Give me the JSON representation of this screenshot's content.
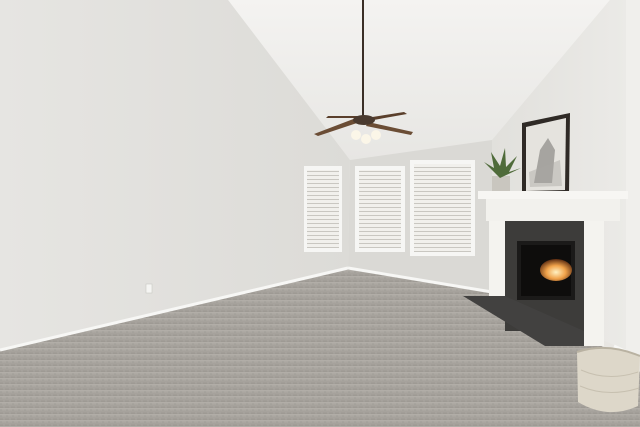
{
  "scene": {
    "subject": "empty-living-room",
    "colors": {
      "left_wall": "#e4e3df",
      "back_wall": "#dcdbd7",
      "right_wall": "#e9e8e5",
      "ceiling": "#f1f0ee",
      "carpet": "#a7a39d",
      "mantel": "#f7f6f3",
      "tile": "#3d3c3a",
      "fan_blade": "#6b4d35",
      "basket": "#ddd7c9"
    },
    "objects": {
      "ceiling_fan": "ceiling-fan",
      "fireplace": "fireplace",
      "framed_art": "framed-art",
      "potted_plant": "potted-plant",
      "wicker_basket": "wicker-basket",
      "windows": [
        "window-left",
        "window-center",
        "window-right"
      ]
    }
  }
}
